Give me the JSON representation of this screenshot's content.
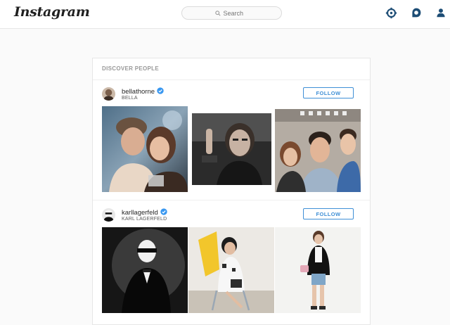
{
  "app": {
    "logo": "Instagram"
  },
  "header": {
    "search_placeholder": "Search",
    "icons": [
      "compass-icon",
      "activity-icon",
      "profile-icon"
    ],
    "icon_color": "#1d4d75"
  },
  "discover": {
    "title": "DISCOVER PEOPLE",
    "follow_label": "FOLLOW",
    "users": [
      {
        "username": "bellathorne",
        "full_name": "BELLA",
        "verified": true
      },
      {
        "username": "karllagerfeld",
        "full_name": "KARL LAGERFELD",
        "verified": true
      }
    ]
  },
  "colors": {
    "accent": "#3f8fd6",
    "verified_badge": "#3897f0"
  }
}
